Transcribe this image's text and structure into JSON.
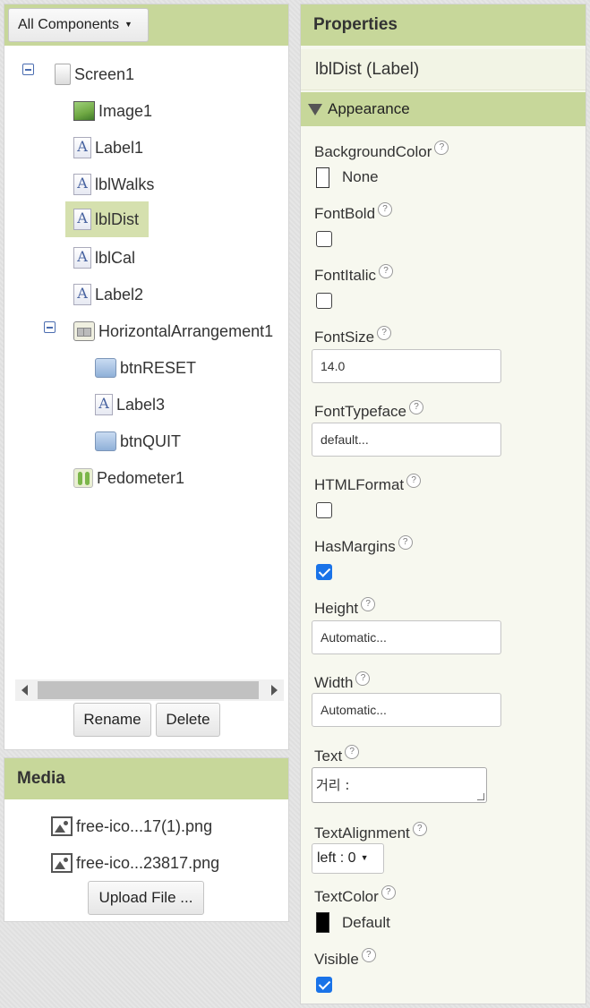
{
  "components_panel": {
    "dropdown_label": "All Components",
    "tree": [
      {
        "label": "Screen1",
        "icon": "screen-icon"
      },
      {
        "label": "Image1",
        "icon": "image-icon"
      },
      {
        "label": "Label1",
        "icon": "label-icon"
      },
      {
        "label": "lblWalks",
        "icon": "label-icon"
      },
      {
        "label": "lblDist",
        "icon": "label-icon",
        "selected": true
      },
      {
        "label": "lblCal",
        "icon": "label-icon"
      },
      {
        "label": "Label2",
        "icon": "label-icon"
      },
      {
        "label": "HorizontalArrangement1",
        "icon": "horizontal-arrangement-icon"
      },
      {
        "label": "btnRESET",
        "icon": "button-icon"
      },
      {
        "label": "Label3",
        "icon": "label-icon"
      },
      {
        "label": "btnQUIT",
        "icon": "button-icon"
      },
      {
        "label": "Pedometer1",
        "icon": "pedometer-icon"
      }
    ],
    "rename_label": "Rename",
    "delete_label": "Delete"
  },
  "media_panel": {
    "title": "Media",
    "files": [
      "free-ico...17(1).png",
      "free-ico...23817.png"
    ],
    "upload_label": "Upload File ..."
  },
  "properties_panel": {
    "title": "Properties",
    "component_title": "lblDist (Label)",
    "section_label": "Appearance",
    "help_glyph": "?",
    "props": {
      "background_color": {
        "label": "BackgroundColor",
        "value": "None",
        "swatch": "#ffffff"
      },
      "font_bold": {
        "label": "FontBold",
        "checked": false
      },
      "font_italic": {
        "label": "FontItalic",
        "checked": false
      },
      "font_size": {
        "label": "FontSize",
        "value": "14.0"
      },
      "font_typeface": {
        "label": "FontTypeface",
        "value": "default..."
      },
      "html_format": {
        "label": "HTMLFormat",
        "checked": false
      },
      "has_margins": {
        "label": "HasMargins",
        "checked": true
      },
      "height": {
        "label": "Height",
        "value": "Automatic..."
      },
      "width": {
        "label": "Width",
        "value": "Automatic..."
      },
      "text": {
        "label": "Text",
        "value": "거리 :"
      },
      "text_alignment": {
        "label": "TextAlignment",
        "value": "left : 0"
      },
      "text_color": {
        "label": "TextColor",
        "value": "Default",
        "swatch": "#000000"
      },
      "visible": {
        "label": "Visible",
        "checked": true
      }
    }
  },
  "colors": {
    "header_bg": "#c7d79a",
    "selected_bg": "#d5e0ae",
    "check_blue": "#1a73e8"
  }
}
